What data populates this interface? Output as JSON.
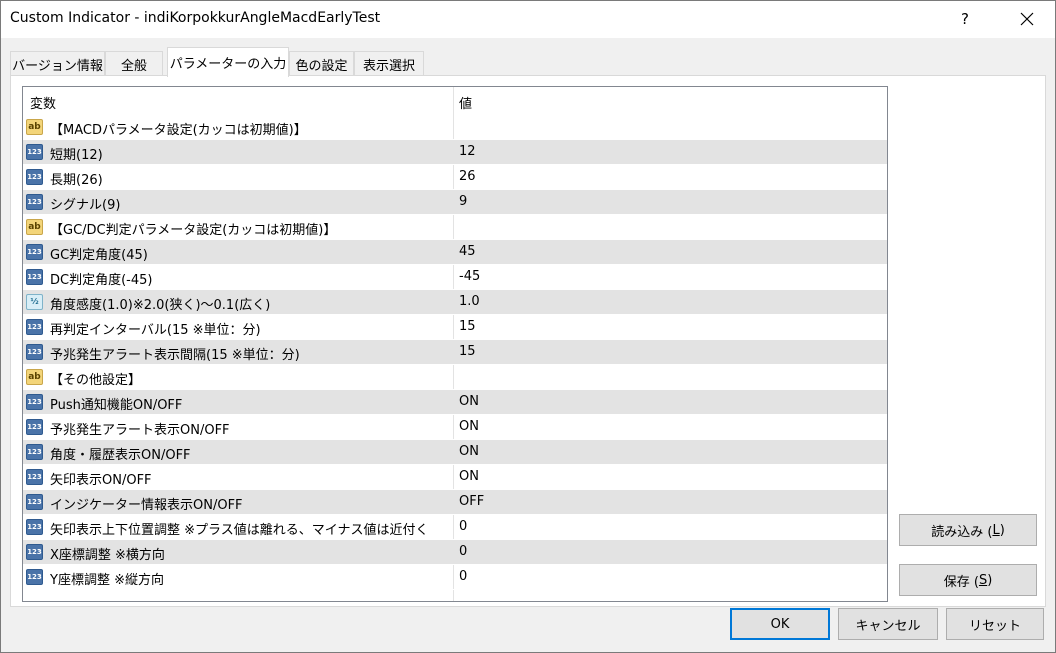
{
  "window": {
    "title": "Custom Indicator - indiKorpokkurAngleMacdEarlyTest",
    "help_label": "?"
  },
  "tabs": [
    {
      "label": "バージョン情報"
    },
    {
      "label": "全般"
    },
    {
      "label": "パラメーターの入力"
    },
    {
      "label": "色の設定"
    },
    {
      "label": "表示選択"
    }
  ],
  "active_tab": "パラメーターの入力",
  "grid": {
    "header_variable": "変数",
    "header_value": "値",
    "rows": [
      {
        "type": "ab",
        "name": "【MACDパラメータ設定(カッコは初期値)】",
        "value": ""
      },
      {
        "type": "123",
        "name": "短期(12)",
        "value": "12"
      },
      {
        "type": "123",
        "name": "長期(26)",
        "value": "26"
      },
      {
        "type": "123",
        "name": "シグナル(9)",
        "value": "9"
      },
      {
        "type": "ab",
        "name": "【GC/DC判定パラメータ設定(カッコは初期値)】",
        "value": ""
      },
      {
        "type": "123",
        "name": "GC判定角度(45)",
        "value": "45"
      },
      {
        "type": "123",
        "name": "DC判定角度(-45)",
        "value": "-45"
      },
      {
        "type": "1/2",
        "name": "角度感度(1.0)※2.0(狭く)～0.1(広く)",
        "value": "1.0"
      },
      {
        "type": "123",
        "name": "再判定インターバル(15 ※単位：分)",
        "value": "15"
      },
      {
        "type": "123",
        "name": "予兆発生アラート表示間隔(15 ※単位：分)",
        "value": "15"
      },
      {
        "type": "ab",
        "name": "【その他設定】",
        "value": ""
      },
      {
        "type": "123",
        "name": "Push通知機能ON/OFF",
        "value": "ON"
      },
      {
        "type": "123",
        "name": "予兆発生アラート表示ON/OFF",
        "value": "ON"
      },
      {
        "type": "123",
        "name": "角度・履歴表示ON/OFF",
        "value": "ON"
      },
      {
        "type": "123",
        "name": "矢印表示ON/OFF",
        "value": "ON"
      },
      {
        "type": "123",
        "name": "インジケーター情報表示ON/OFF",
        "value": "OFF"
      },
      {
        "type": "123",
        "name": "矢印表示上下位置調整 ※プラス値は離れる、マイナス値は近付く",
        "value": "0"
      },
      {
        "type": "123",
        "name": "X座標調整 ※横方向",
        "value": "0"
      },
      {
        "type": "123",
        "name": "Y座標調整 ※縦方向",
        "value": "0"
      }
    ]
  },
  "buttons": {
    "load_label": "読み込み (",
    "load_key": "L",
    "save_label": "保存 (",
    "save_key": "S",
    "close_paren": ")",
    "ok_label": "OK",
    "cancel_label": "キャンセル",
    "reset_label": "リセット"
  }
}
